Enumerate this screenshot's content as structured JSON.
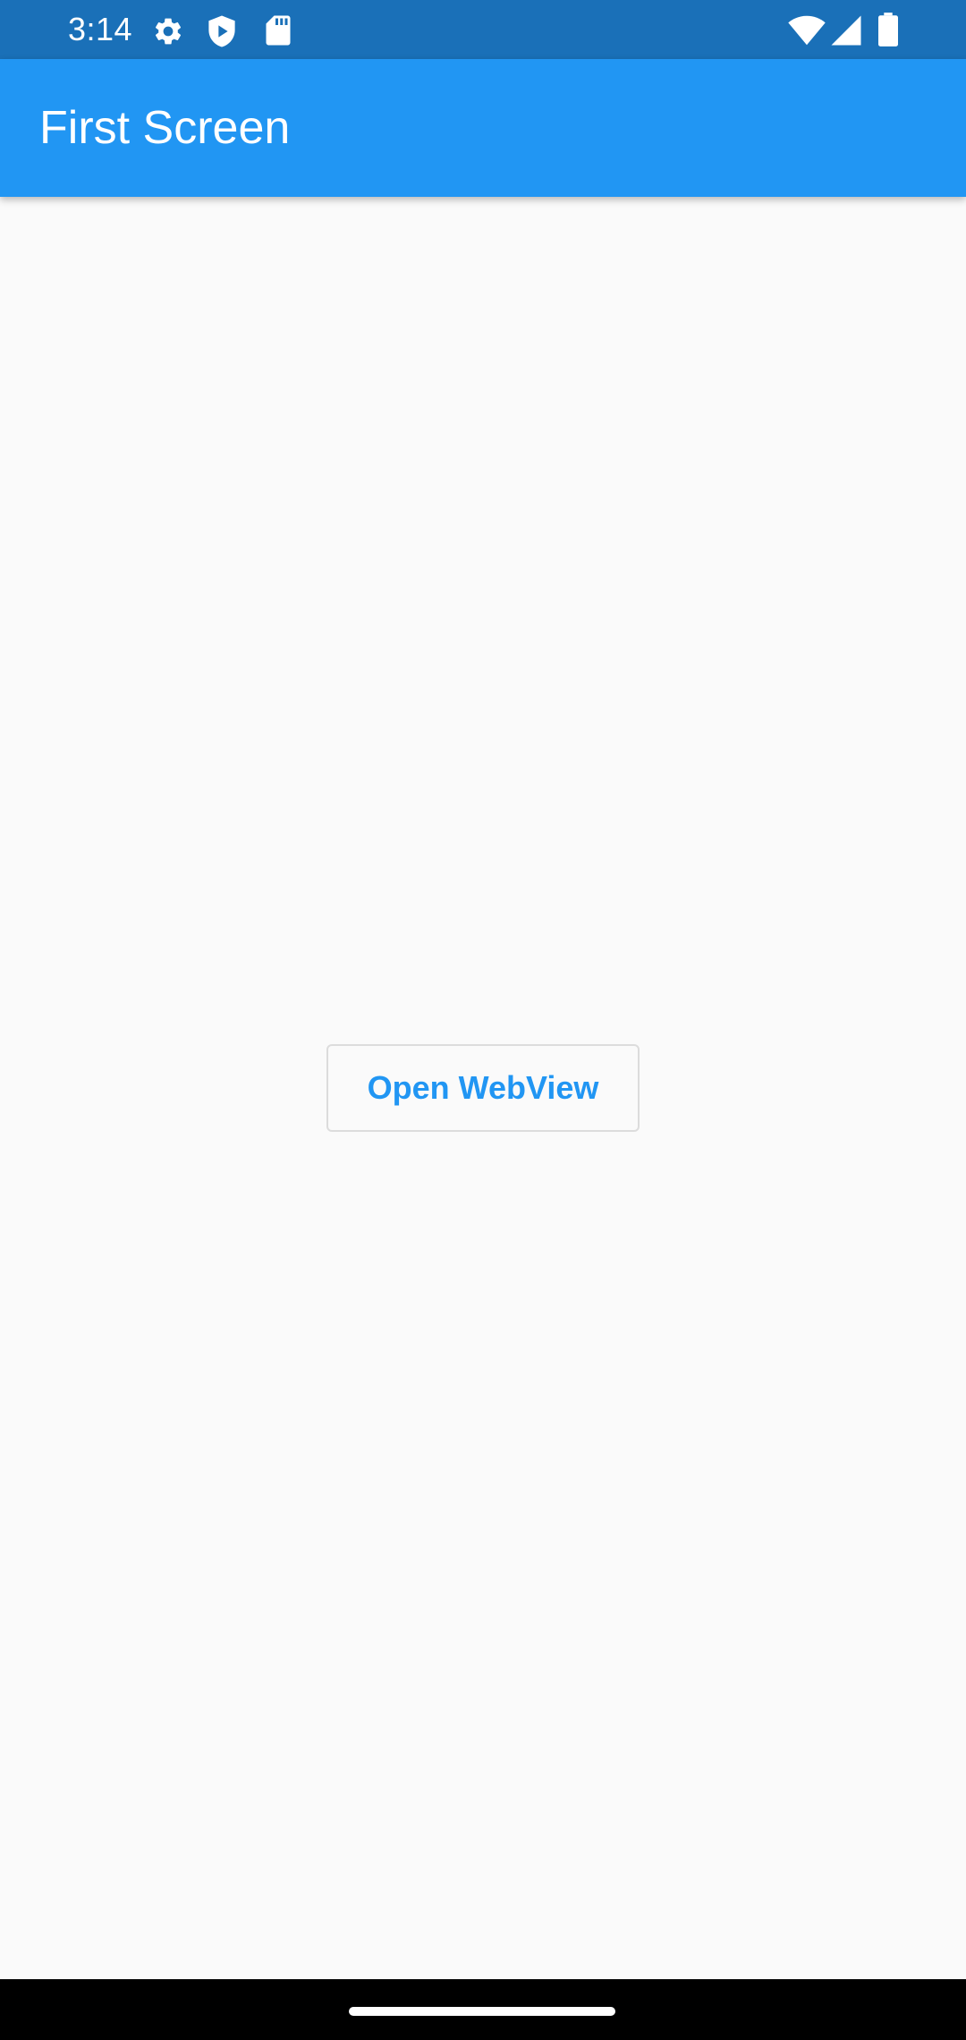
{
  "status_bar": {
    "time": "3:14",
    "left_icons": [
      "gear-icon",
      "shield-play-icon",
      "sd-card-icon"
    ],
    "right_icons": [
      "wifi-icon",
      "signal-icon",
      "battery-icon"
    ],
    "background": "#1a70b8"
  },
  "app_bar": {
    "title": "First Screen",
    "background": "#2196f3"
  },
  "main": {
    "open_webview_label": "Open WebView",
    "accent": "#2196f3",
    "background": "#fafafa"
  },
  "nav_bar": {
    "background": "#000000"
  }
}
